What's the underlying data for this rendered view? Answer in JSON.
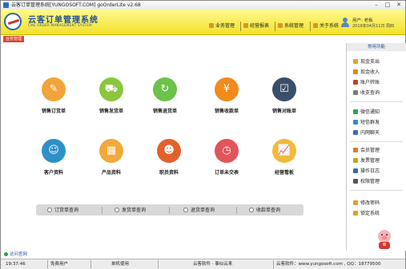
{
  "window": {
    "title": "云客订单管理系统[YUNGOSOFT.COM] goOrderLite v2.68"
  },
  "brand": {
    "name": "云客订单管理系统",
    "subtitle": "CME ORDER MANAGEMENT SYSTEM"
  },
  "header_nav": [
    {
      "label": "业务管理",
      "icon": "briefcase-icon"
    },
    {
      "label": "经营报表",
      "icon": "report-icon"
    },
    {
      "label": "系统管理",
      "icon": "settings-icon"
    },
    {
      "label": "关于系统",
      "icon": "info-icon"
    }
  ],
  "user": {
    "name": "用户: 老板",
    "date": "2019年04月11日 周四"
  },
  "breadcrumb": "业务管理",
  "tiles_row1": [
    {
      "label": "销售订货单",
      "icon": "clipboard-icon",
      "color": "#f2a43a",
      "glyph": "✎"
    },
    {
      "label": "销售发货单",
      "icon": "truck-icon",
      "color": "#8dc53f",
      "glyph": "⛟"
    },
    {
      "label": "销售退货单",
      "icon": "refresh-icon",
      "color": "#6cc24a",
      "glyph": "↻"
    },
    {
      "label": "销售收款单",
      "icon": "yen-icon",
      "color": "#f28a1c",
      "glyph": "¥"
    },
    {
      "label": "销售对账单",
      "icon": "checklist-icon",
      "color": "#3a4f6a",
      "glyph": "☑"
    }
  ],
  "tiles_row2": [
    {
      "label": "客户资料",
      "icon": "customer-icon",
      "color": "#2e8fc9",
      "glyph": "☺"
    },
    {
      "label": "产品资料",
      "icon": "products-icon",
      "color": "#f0a93a",
      "glyph": "▦"
    },
    {
      "label": "职员资料",
      "icon": "staff-icon",
      "color": "#e2612c",
      "glyph": "☻"
    },
    {
      "label": "订单未交表",
      "icon": "clock-report-icon",
      "color": "#e2545b",
      "glyph": "◷"
    },
    {
      "label": "经营看板",
      "icon": "chart-board-icon",
      "color": "#f2b93a",
      "glyph": "📈"
    }
  ],
  "queries": [
    "订货单查询",
    "发货单查询",
    "退货单查询",
    "收款单查询"
  ],
  "sidebar": {
    "title": "常用功能",
    "groups": [
      [
        {
          "label": "现金支出",
          "icon": "cash-out-icon",
          "color": "#e0a22a"
        },
        {
          "label": "现金收入",
          "icon": "cash-in-icon",
          "color": "#d98a1e"
        },
        {
          "label": "账户转账",
          "icon": "transfer-icon",
          "color": "#c0442c"
        },
        {
          "label": "收支查询",
          "icon": "search-icon",
          "color": "#7a7a7a"
        }
      ],
      [
        {
          "label": "微信通知",
          "icon": "wechat-icon",
          "color": "#2aa84a"
        },
        {
          "label": "短信群发",
          "icon": "sms-icon",
          "color": "#3b86c9"
        },
        {
          "label": "内网聊天",
          "icon": "chat-icon",
          "color": "#3a6db4"
        }
      ],
      [
        {
          "label": "会员管理",
          "icon": "member-icon",
          "color": "#e07a2a"
        },
        {
          "label": "发票管理",
          "icon": "invoice-icon",
          "color": "#c9a12a"
        },
        {
          "label": "操作日志",
          "icon": "log-icon",
          "color": "#3a6aa8"
        },
        {
          "label": "权限管理",
          "icon": "permission-icon",
          "color": "#555555"
        }
      ],
      [
        {
          "label": "修改密码",
          "icon": "key-icon",
          "color": "#d9a12a"
        },
        {
          "label": "锁定系统",
          "icon": "lock-icon",
          "color": "#d9a12a"
        }
      ]
    ]
  },
  "visit_link": "访问官网",
  "status": {
    "time": "19:37:46",
    "edition": "免费用户",
    "mode": "单机使用",
    "company": "云客软件 · 事似云来",
    "contact": "云客软件：www.yungosoft.com , QQ：18779500"
  },
  "colors": {
    "header_yellow": "#f2e12a",
    "accent_blue": "#1e4f9a",
    "crumb_red": "#d9472c"
  }
}
